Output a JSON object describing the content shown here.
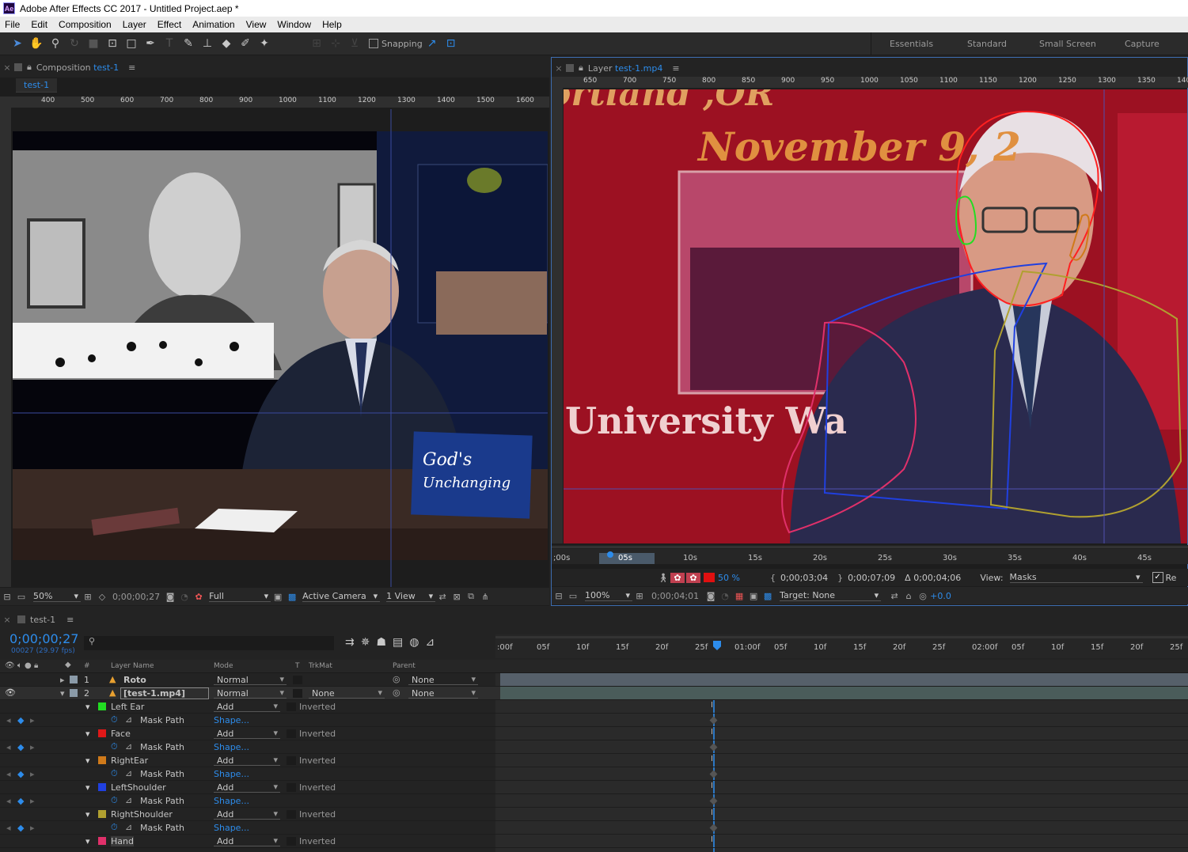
{
  "window": {
    "title": "Adobe After Effects CC 2017 - Untitled Project.aep *",
    "icon": "Ae"
  },
  "menu": [
    "File",
    "Edit",
    "Composition",
    "Layer",
    "Effect",
    "Animation",
    "View",
    "Window",
    "Help"
  ],
  "toolbar": {
    "snapping_label": "Snapping",
    "workspaces": [
      "Essentials",
      "Standard",
      "Small Screen",
      "Capture"
    ]
  },
  "comp_panel": {
    "title_prefix": "Composition",
    "title_name": "test-1",
    "tab": "test-1",
    "ruler_ticks": [
      "400",
      "500",
      "600",
      "700",
      "800",
      "900",
      "1000",
      "1100",
      "1200",
      "1300",
      "1400",
      "1500",
      "1600"
    ],
    "footer": {
      "zoom": "50%",
      "timecode": "0;00;00;27",
      "resolution": "Full",
      "camera": "Active Camera",
      "views": "1 View"
    }
  },
  "layer_panel": {
    "title_prefix": "Layer",
    "title_name": "test-1.mp4",
    "ruler_ticks": [
      "650",
      "700",
      "750",
      "800",
      "850",
      "900",
      "950",
      "1000",
      "1050",
      "1100",
      "1150",
      "1200",
      "1250",
      "1300",
      "1350",
      "140"
    ],
    "video_text": {
      "top": "ortland ,OR",
      "date": "November 9, 2",
      "bottom": "University Wa"
    },
    "time_ticks": [
      ";00s",
      "05s",
      "10s",
      "15s",
      "20s",
      "25s",
      "30s",
      "35s",
      "40s",
      "45s"
    ],
    "controls": {
      "opacity": "50 %",
      "in_point": "0;00;03;04",
      "out_point": "0;00;07;09",
      "duration": "Δ 0;00;04;06",
      "view_label": "View:",
      "view_value": "Masks",
      "render_label": "Re"
    },
    "footer": {
      "zoom": "100%",
      "timecode": "0;00;04;01",
      "target": "Target: None",
      "exposure": "+0.0"
    }
  },
  "timeline": {
    "tab": "test-1",
    "timecode": "0;00;00;27",
    "fps": "00027 (29.97 fps)",
    "columns": {
      "layer_name": "Layer Name",
      "mode": "Mode",
      "t": "T",
      "trkmat": "TrkMat",
      "parent": "Parent",
      "num": "#"
    },
    "ruler": [
      ":00f",
      "05f",
      "10f",
      "15f",
      "20f",
      "25f",
      "01:00f",
      "05f",
      "10f",
      "15f",
      "20f",
      "25f",
      "02:00f",
      "05f",
      "10f",
      "15f",
      "20f",
      "25f"
    ],
    "layers": [
      {
        "num": "1",
        "name": "Roto",
        "mode": "Normal",
        "trkmat": "",
        "parent": "None"
      },
      {
        "num": "2",
        "name": "[test-1.mp4]",
        "mode": "Normal",
        "trkmat": "None",
        "parent": "None"
      }
    ],
    "masks": [
      {
        "name": "Left Ear",
        "color": "#22dd22",
        "mode": "Add",
        "inverted": "Inverted",
        "prop": "Mask Path",
        "value": "Shape..."
      },
      {
        "name": "Face",
        "color": "#e01818",
        "mode": "Add",
        "inverted": "Inverted",
        "prop": "Mask Path",
        "value": "Shape..."
      },
      {
        "name": "RightEar",
        "color": "#d07a1a",
        "mode": "Add",
        "inverted": "Inverted",
        "prop": "Mask Path",
        "value": "Shape..."
      },
      {
        "name": "LeftShoulder",
        "color": "#2040e0",
        "mode": "Add",
        "inverted": "Inverted",
        "prop": "Mask Path",
        "value": "Shape..."
      },
      {
        "name": "RightShoulder",
        "color": "#b0a030",
        "mode": "Add",
        "inverted": "Inverted",
        "prop": "Mask Path",
        "value": "Shape..."
      },
      {
        "name": "Hand",
        "color": "#e0306a",
        "mode": "Add",
        "inverted": "Inverted"
      }
    ]
  },
  "colors": {
    "accent": "#2d8ceb",
    "panel": "#232323",
    "overlay": "#a01020"
  }
}
